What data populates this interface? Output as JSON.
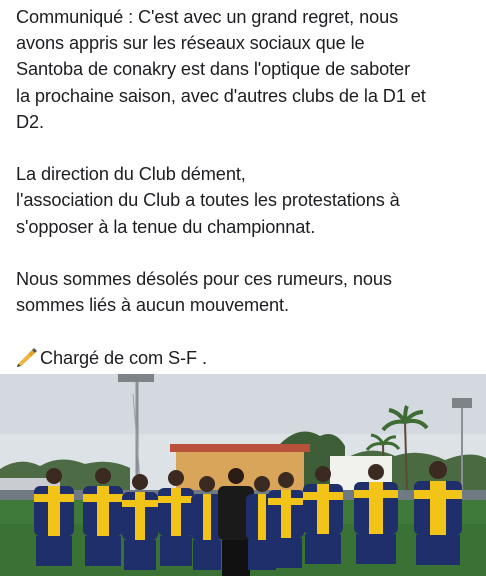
{
  "post": {
    "paragraphs": [
      {
        "lines": [
          "Communiqué : C'est avec un grand regret, nous",
          "avons appris sur les réseaux sociaux que le",
          "Santoba de conakry est dans l'optique de saboter",
          "la prochaine saison, avec d'autres clubs de la D1 et",
          "D2."
        ]
      },
      {
        "lines": [
          "La direction du Club dément,",
          "l'association du Club a toutes les protestations à",
          "s'opposer à la tenue du championnat."
        ]
      },
      {
        "lines": [
          "Nous sommes désolés pour ces rumeurs, nous",
          "sommes liés à aucun mouvement."
        ]
      }
    ],
    "signature": {
      "icon": "writing-hand-icon",
      "text": "Chargé de com S-F ."
    }
  },
  "photo": {
    "description_icon": "team-photo",
    "colors": {
      "sky": "#dfe3e6",
      "pitch": "#3f7a3a",
      "jersey_navy": "#1f2f6b",
      "jersey_yellow": "#f2c418"
    }
  }
}
